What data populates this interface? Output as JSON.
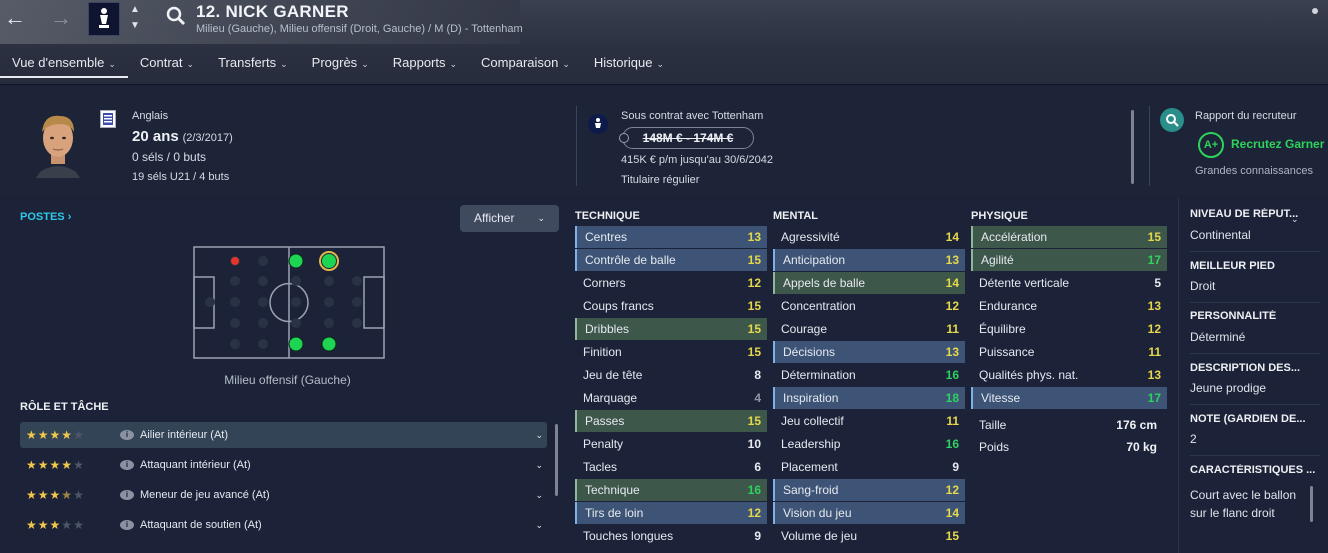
{
  "header": {
    "title": "12. NICK GARNER",
    "subtitle": "Milieu (Gauche), Milieu offensif (Droit, Gauche) / M (D) - Tottenham",
    "back_icon": "arrow-left-icon",
    "forward_icon": "arrow-right-icon",
    "search_icon": "search-icon"
  },
  "tabs": [
    {
      "label": "Vue d'ensemble"
    },
    {
      "label": "Contrat"
    },
    {
      "label": "Transferts"
    },
    {
      "label": "Progrès"
    },
    {
      "label": "Rapports"
    },
    {
      "label": "Comparaison"
    },
    {
      "label": "Historique"
    }
  ],
  "profile": {
    "nationality": "Anglais",
    "age": "20 ans",
    "birth": "(2/3/2017)",
    "caps": "0 séls / 0 buts",
    "u21": "19 séls U21 / 4 buts"
  },
  "contract": {
    "club": "Sous contrat avec Tottenham",
    "value": "148M € - 174M €",
    "wage": "415K € p/m jusqu'au 30/6/2042",
    "status": "Titulaire régulier"
  },
  "scout": {
    "title": "Rapport du recruteur",
    "grade": "A+",
    "recommendation": "Recrutez Garner",
    "knowledge": "Grandes connaissances"
  },
  "positions": {
    "heading": "POSTES",
    "display_button": "Afficher",
    "selected_label": "Milieu offensif (Gauche)"
  },
  "roles": {
    "heading": "RÔLE ET TÂCHE",
    "items": [
      {
        "label": "Ailier intérieur (At)",
        "stars": 4
      },
      {
        "label": "Attaquant intérieur (At)",
        "stars": 4
      },
      {
        "label": "Meneur de jeu avancé (At)",
        "stars": 3.5
      },
      {
        "label": "Attaquant de soutien (At)",
        "stars": 3
      }
    ]
  },
  "technique": {
    "heading": "TECHNIQUE",
    "items": [
      {
        "name": "Centres",
        "value": "13",
        "hl": "blue"
      },
      {
        "name": "Contrôle de balle",
        "value": "15",
        "hl": "blue"
      },
      {
        "name": "Corners",
        "value": "12",
        "hl": ""
      },
      {
        "name": "Coups francs",
        "value": "15",
        "hl": ""
      },
      {
        "name": "Dribbles",
        "value": "15",
        "hl": "green"
      },
      {
        "name": "Finition",
        "value": "15",
        "hl": ""
      },
      {
        "name": "Jeu de tête",
        "value": "8",
        "hl": ""
      },
      {
        "name": "Marquage",
        "value": "4",
        "hl": ""
      },
      {
        "name": "Passes",
        "value": "15",
        "hl": "green"
      },
      {
        "name": "Penalty",
        "value": "10",
        "hl": ""
      },
      {
        "name": "Tacles",
        "value": "6",
        "hl": ""
      },
      {
        "name": "Technique",
        "value": "16",
        "hl": "green"
      },
      {
        "name": "Tirs de loin",
        "value": "12",
        "hl": "blue"
      },
      {
        "name": "Touches longues",
        "value": "9",
        "hl": ""
      }
    ]
  },
  "mental": {
    "heading": "MENTAL",
    "items": [
      {
        "name": "Agressivité",
        "value": "14",
        "hl": ""
      },
      {
        "name": "Anticipation",
        "value": "13",
        "hl": "blue"
      },
      {
        "name": "Appels de balle",
        "value": "14",
        "hl": "green"
      },
      {
        "name": "Concentration",
        "value": "12",
        "hl": ""
      },
      {
        "name": "Courage",
        "value": "11",
        "hl": ""
      },
      {
        "name": "Décisions",
        "value": "13",
        "hl": "blue"
      },
      {
        "name": "Détermination",
        "value": "16",
        "hl": ""
      },
      {
        "name": "Inspiration",
        "value": "18",
        "hl": "blue"
      },
      {
        "name": "Jeu collectif",
        "value": "11",
        "hl": ""
      },
      {
        "name": "Leadership",
        "value": "16",
        "hl": ""
      },
      {
        "name": "Placement",
        "value": "9",
        "hl": ""
      },
      {
        "name": "Sang-froid",
        "value": "12",
        "hl": "blue"
      },
      {
        "name": "Vision du jeu",
        "value": "14",
        "hl": "blue"
      },
      {
        "name": "Volume de jeu",
        "value": "15",
        "hl": ""
      }
    ]
  },
  "physique": {
    "heading": "PHYSIQUE",
    "items": [
      {
        "name": "Accélération",
        "value": "15",
        "hl": "green"
      },
      {
        "name": "Agilité",
        "value": "17",
        "hl": "green"
      },
      {
        "name": "Détente verticale",
        "value": "5",
        "hl": ""
      },
      {
        "name": "Endurance",
        "value": "13",
        "hl": ""
      },
      {
        "name": "Équilibre",
        "value": "12",
        "hl": ""
      },
      {
        "name": "Puissance",
        "value": "11",
        "hl": ""
      },
      {
        "name": "Qualités phys. nat.",
        "value": "13",
        "hl": ""
      },
      {
        "name": "Vitesse",
        "value": "17",
        "hl": "blue"
      }
    ],
    "height_label": "Taille",
    "height": "176 cm",
    "weight_label": "Poids",
    "weight": "70 kg"
  },
  "sidebar": {
    "items": [
      {
        "heading": "NIVEAU DE RÉPUT...",
        "value": "Continental"
      },
      {
        "heading": "MEILLEUR PIED",
        "value": "Droit"
      },
      {
        "heading": "PERSONNALITÉ",
        "value": "Déterminé"
      },
      {
        "heading": "DESCRIPTION DES...",
        "value": "Jeune prodige"
      },
      {
        "heading": "NOTE (GARDIEN DE...",
        "value": "2"
      },
      {
        "heading": "CARACTÉRISTIQUES ...",
        "value": "Court avec le ballon sur le flanc droit"
      }
    ]
  },
  "colors": {
    "accent_cyan": "#2ec7e8",
    "grade_green": "#2dd35a",
    "value_yellow": "#e6d84a",
    "value_green": "#2fd160"
  }
}
